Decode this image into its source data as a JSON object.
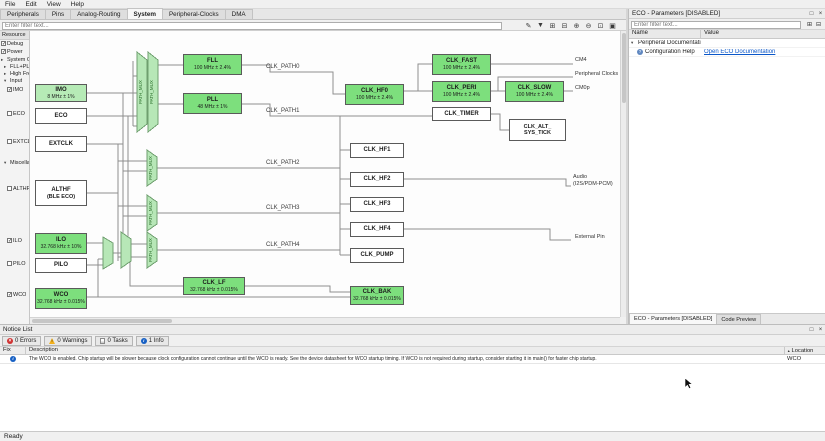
{
  "glyphs": {
    "check": "✓",
    "collapsed": "▸",
    "expanded": "▾",
    "float": "□",
    "close": "×",
    "expand_all": "⊞",
    "collapse_all": "⊟",
    "filter": "▼",
    "edit": "✎",
    "zoom_in": "⊕",
    "zoom_out": "⊖",
    "zoom_fit": "⊡",
    "zoom_sel": "▣",
    "help": "?",
    "info": "i",
    "error": "×",
    "warning": "!",
    "sort": "▲"
  },
  "menu": {
    "items": [
      "File",
      "Edit",
      "View",
      "Help"
    ]
  },
  "tabs": {
    "items": [
      "Peripherals",
      "Pins",
      "Analog-Routing",
      "System",
      "Peripheral-Clocks",
      "DMA"
    ]
  },
  "canvas_toolbar": {
    "filter_placeholder": "Enter filter text..."
  },
  "resource": {
    "title": "Resource",
    "groups": {
      "debug": "Debug",
      "power": "Power",
      "system": "System Clocks",
      "fll": "FLL+PLL",
      "high": "High Frequency",
      "input": "Input",
      "misc": "Miscellaneous"
    },
    "inputs": {
      "imo": "IMO",
      "eco": "ECO",
      "extclk": "EXTCLK",
      "althf": "ALTHF",
      "ilo": "ILO",
      "pilo": "PILO",
      "wco": "WCO"
    }
  },
  "diagram": {
    "mux_label": "PATH_MUX",
    "nodes": {
      "imo": {
        "name": "IMO",
        "value": "8 MHz ± 1%"
      },
      "eco": {
        "name": "ECO"
      },
      "extclk": {
        "name": "EXTCLK"
      },
      "althf": {
        "name": "ALTHF",
        "name2": "(BLE ECO)"
      },
      "ilo": {
        "name": "ILO",
        "value": "32.768 kHz ± 10%"
      },
      "pilo": {
        "name": "PILO"
      },
      "wco": {
        "name": "WCO",
        "value": "32.768 kHz ± 0.015%"
      },
      "fll": {
        "name": "FLL",
        "value": "100 MHz ± 2.4%"
      },
      "pll": {
        "name": "PLL",
        "value": "48 MHz ± 1%"
      },
      "clk_hf0": {
        "name": "CLK_HF0",
        "value": "100 MHz ± 2.4%"
      },
      "clk_hf1": {
        "name": "CLK_HF1"
      },
      "clk_hf2": {
        "name": "CLK_HF2"
      },
      "clk_hf3": {
        "name": "CLK_HF3"
      },
      "clk_hf4": {
        "name": "CLK_HF4"
      },
      "clk_pump": {
        "name": "CLK_PUMP"
      },
      "clk_fast": {
        "name": "CLK_FAST",
        "value": "100 MHz ± 2.4%"
      },
      "clk_peri": {
        "name": "CLK_PERI",
        "value": "100 MHz ± 2.4%"
      },
      "clk_slow": {
        "name": "CLK_SLOW",
        "value": "100 MHz ± 2.4%"
      },
      "clk_timer": {
        "name": "CLK_TIMER"
      },
      "clk_alt_sys_tick": {
        "name": "CLK_ALT_",
        "name2": "SYS_TICK"
      },
      "clk_lf": {
        "name": "CLK_LF",
        "value": "32.768 kHz ± 0.015%"
      },
      "clk_bak": {
        "name": "CLK_BAK",
        "value": "32.768 kHz ± 0.015%"
      }
    },
    "paths": [
      "CLK_PATH0",
      "CLK_PATH1",
      "CLK_PATH2",
      "CLK_PATH3",
      "CLK_PATH4"
    ],
    "endpoints": {
      "cm4": "CM4",
      "peripheral": "Peripheral Clocks",
      "cm0p": "CM0p",
      "audio": "Audio",
      "audio2": "(I2S/PDM-PCM)",
      "external": "External Pin"
    }
  },
  "params_panel": {
    "title": "ECO - Parameters [DISABLED]",
    "filter_placeholder": "Enter filter text...",
    "columns": [
      "Name",
      "Value"
    ],
    "rows": {
      "group": "Peripheral Documentation",
      "help_name": "Configuration Help",
      "help_value": "Open ECO Documentation"
    },
    "tabs": [
      "ECO - Parameters [DISABLED]",
      "Code Preview"
    ]
  },
  "notice": {
    "title": "Notice List",
    "counters": [
      "0 Errors",
      "0 Warnings",
      "0 Tasks",
      "1 Info"
    ],
    "columns": [
      "Fix",
      "Description",
      "Location"
    ],
    "rows": [
      {
        "description": "The WCO is enabled. Chip startup will be slower because clock configuration cannot continue until the WCO is ready. See the device datasheet for WCO startup timing. If WCO is not required during startup, consider starting it in main() for faster chip startup.",
        "location": "WCO"
      }
    ]
  },
  "status_bar": {
    "text": "Ready"
  }
}
